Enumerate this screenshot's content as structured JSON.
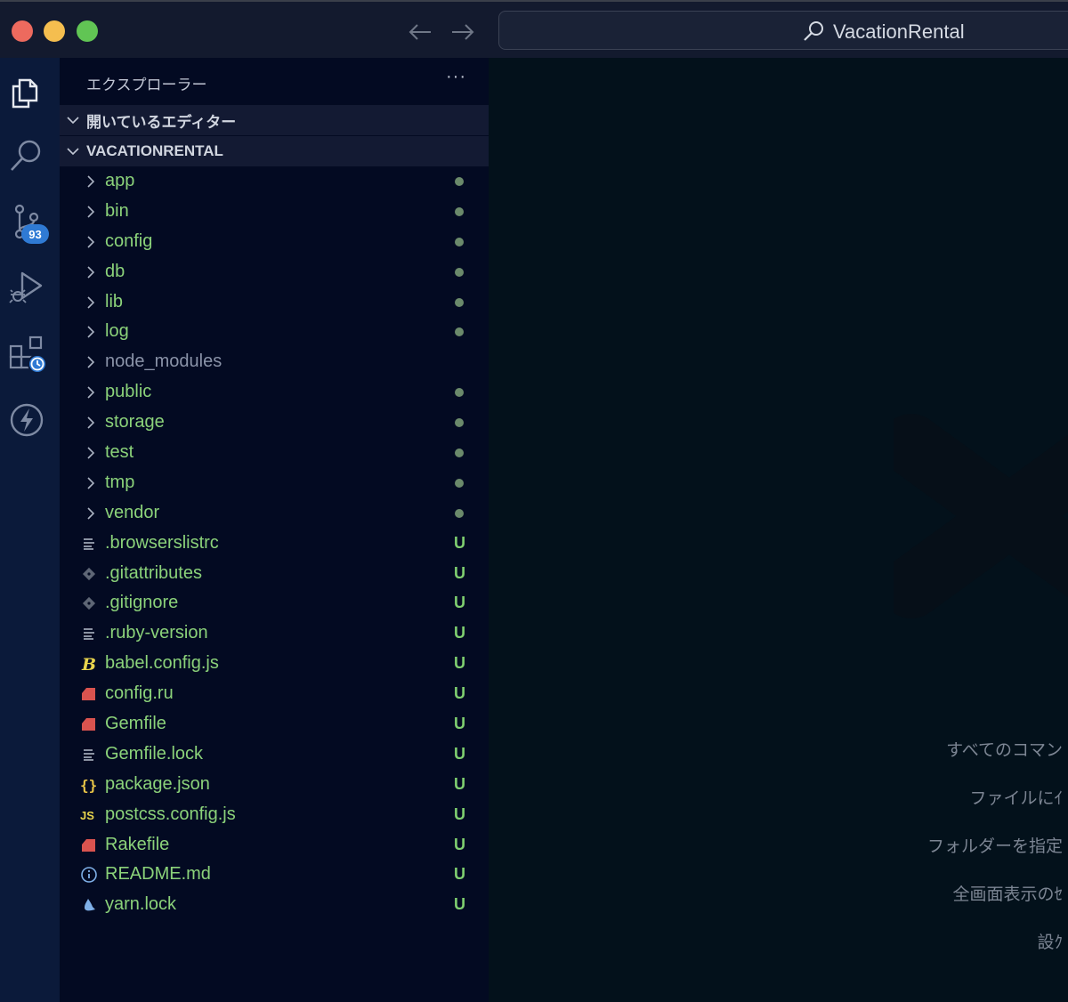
{
  "titlebar": {
    "title": "VacationRental",
    "back_icon": "arrow-left-icon",
    "forward_icon": "arrow-right-icon"
  },
  "activity_bar": {
    "items": [
      {
        "name": "explorer",
        "icon": "files-icon"
      },
      {
        "name": "search",
        "icon": "search-icon"
      },
      {
        "name": "source-control",
        "icon": "source-control-icon",
        "badge": "93"
      },
      {
        "name": "run-debug",
        "icon": "run-debug-icon"
      },
      {
        "name": "extensions",
        "icon": "extensions-icon"
      },
      {
        "name": "power",
        "icon": "lightning-icon"
      }
    ]
  },
  "sidebar": {
    "header": "エクスプローラー",
    "more": "···",
    "open_editors_label": "開いているエディター",
    "project_label": "VACATIONRENTAL",
    "items": [
      {
        "name": "app",
        "type": "folder",
        "status": "dot"
      },
      {
        "name": "bin",
        "type": "folder",
        "status": "dot"
      },
      {
        "name": "config",
        "type": "folder",
        "status": "dot"
      },
      {
        "name": "db",
        "type": "folder",
        "status": "dot"
      },
      {
        "name": "lib",
        "type": "folder",
        "status": "dot"
      },
      {
        "name": "log",
        "type": "folder",
        "status": "dot"
      },
      {
        "name": "node_modules",
        "type": "folder",
        "status": "",
        "muted": true
      },
      {
        "name": "public",
        "type": "folder",
        "status": "dot"
      },
      {
        "name": "storage",
        "type": "folder",
        "status": "dot"
      },
      {
        "name": "test",
        "type": "folder",
        "status": "dot"
      },
      {
        "name": "tmp",
        "type": "folder",
        "status": "dot"
      },
      {
        "name": "vendor",
        "type": "folder",
        "status": "dot"
      },
      {
        "name": ".browserslistrc",
        "type": "file",
        "icon": "lines-icon",
        "status": "U"
      },
      {
        "name": ".gitattributes",
        "type": "file",
        "icon": "git-icon",
        "status": "U"
      },
      {
        "name": ".gitignore",
        "type": "file",
        "icon": "git-icon",
        "status": "U"
      },
      {
        "name": ".ruby-version",
        "type": "file",
        "icon": "lines-icon",
        "status": "U"
      },
      {
        "name": "babel.config.js",
        "type": "file",
        "icon": "babel-icon",
        "status": "U"
      },
      {
        "name": "config.ru",
        "type": "file",
        "icon": "ruby-icon",
        "status": "U"
      },
      {
        "name": "Gemfile",
        "type": "file",
        "icon": "ruby-icon",
        "status": "U"
      },
      {
        "name": "Gemfile.lock",
        "type": "file",
        "icon": "lines-icon",
        "status": "U"
      },
      {
        "name": "package.json",
        "type": "file",
        "icon": "json-icon",
        "status": "U"
      },
      {
        "name": "postcss.config.js",
        "type": "file",
        "icon": "js-icon",
        "status": "U"
      },
      {
        "name": "Rakefile",
        "type": "file",
        "icon": "ruby-icon",
        "status": "U"
      },
      {
        "name": "README.md",
        "type": "file",
        "icon": "info-icon",
        "status": "U"
      },
      {
        "name": "yarn.lock",
        "type": "file",
        "icon": "yarn-icon",
        "status": "U"
      }
    ]
  },
  "editor": {
    "hints": [
      "すべてのコマン",
      "ファイルにｲ",
      "フォルダーを指定",
      "全画面表示のｾ",
      "設ｸ"
    ]
  },
  "colors": {
    "tracked_green": "#8bd27a",
    "badge_blue": "#2f7ad4"
  }
}
